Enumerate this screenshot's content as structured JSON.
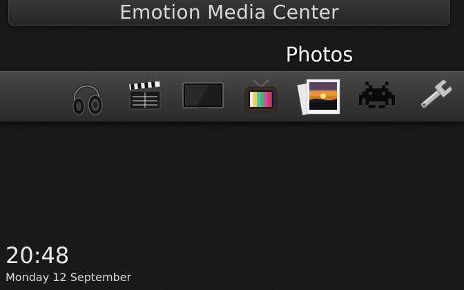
{
  "app": {
    "title": "Emotion Media Center"
  },
  "menu": {
    "selected_label": "Photos",
    "items": [
      {
        "icon": "headphones-icon"
      },
      {
        "icon": "clapperboard-icon"
      },
      {
        "icon": "television-icon"
      },
      {
        "icon": "retro-tv-icon"
      },
      {
        "icon": "photos-icon"
      },
      {
        "icon": "space-invader-icon"
      },
      {
        "icon": "wrench-icon"
      }
    ]
  },
  "status": {
    "time": "20:48",
    "date": "Monday 12 September"
  }
}
